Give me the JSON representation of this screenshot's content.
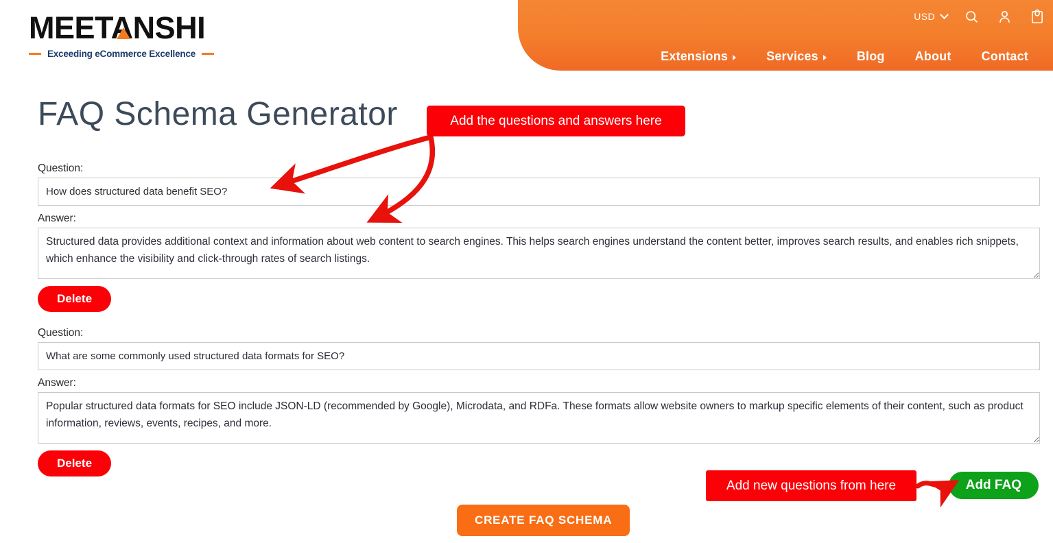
{
  "header": {
    "currency": "USD",
    "currency_icon": "chevron-down-icon",
    "icons": [
      "search-icon",
      "user-account-icon",
      "shopping-bag-icon"
    ],
    "nav": [
      {
        "label": "Extensions",
        "has_submenu": true
      },
      {
        "label": "Services",
        "has_submenu": true
      },
      {
        "label": "Blog",
        "has_submenu": false
      },
      {
        "label": "About",
        "has_submenu": false
      },
      {
        "label": "Contact",
        "has_submenu": false
      }
    ],
    "accent_color": "#f47b20",
    "gradient_top": "#f58634",
    "gradient_bottom": "#f06a26"
  },
  "logo": {
    "wordmark": "MEETANSHI",
    "tagline": "Exceeding eCommerce Excellence",
    "triangle_color": "#f47b20",
    "tagline_color": "#1b3a6b"
  },
  "page": {
    "title": "FAQ Schema Generator"
  },
  "form": {
    "question_label": "Question:",
    "answer_label": "Answer:",
    "delete_label": "Delete",
    "question_placeholder": "",
    "answer_placeholder": "",
    "faqs": [
      {
        "question": "How does structured data benefit SEO?",
        "answer": "Structured data provides additional context and information about web content to search engines. This helps search engines understand the content better, improves search results, and enables rich snippets, which enhance the visibility and click-through rates of search listings."
      },
      {
        "question": "What are some commonly used structured data formats for SEO?",
        "answer": "Popular structured data formats for SEO include JSON-LD (recommended by Google), Microdata, and RDFa. These formats allow website owners to markup specific elements of their content, such as product information, reviews, events, recipes, and more."
      }
    ]
  },
  "actions": {
    "add_faq_label": "Add FAQ",
    "add_faq_color": "#0ea11a",
    "create_schema_label": "CREATE FAQ SCHEMA",
    "create_schema_color": "#f96d14",
    "delete_color": "#fb0007"
  },
  "annotations": {
    "top": "Add the questions and answers here",
    "bottom": "Add new questions from here",
    "color": "#fb0007",
    "arrow_color": "#e8110b"
  }
}
